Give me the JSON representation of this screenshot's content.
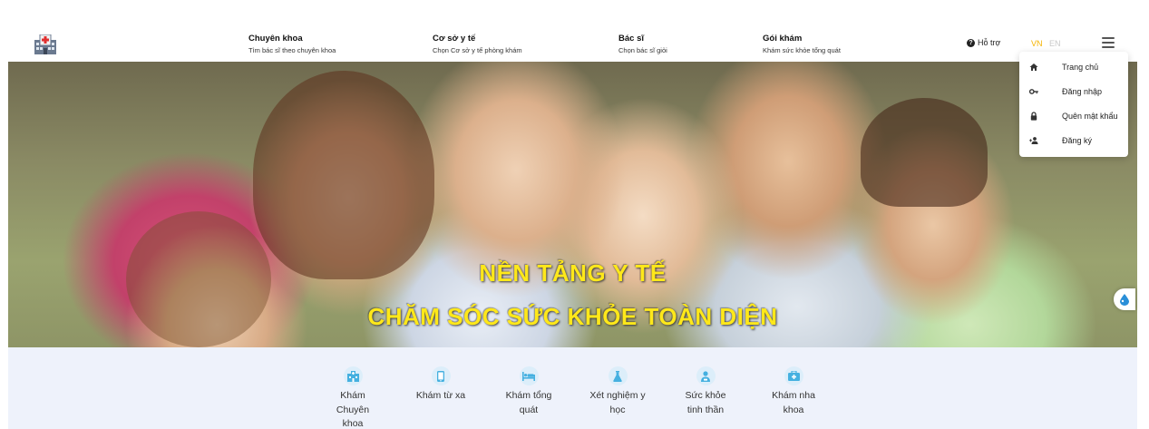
{
  "header": {
    "nav": [
      {
        "title": "Chuyên khoa",
        "subtitle": "Tìm bác sĩ theo chuyên khoa"
      },
      {
        "title": "Cơ sở y tế",
        "subtitle": "Chọn Cơ sở y tế phòng khám"
      },
      {
        "title": "Bác sĩ",
        "subtitle": "Chọn bác sĩ giỏi"
      },
      {
        "title": "Gói khám",
        "subtitle": "Khám sức khỏe tổng quát"
      }
    ],
    "support_label": "Hỗ trợ",
    "lang_vn": "VN",
    "lang_en": "EN",
    "active_lang_color": "#f5b400"
  },
  "dropdown": {
    "items": [
      {
        "label": "Trang chủ",
        "icon": "home-icon"
      },
      {
        "label": "Đăng nhập",
        "icon": "key-icon"
      },
      {
        "label": "Quên mật khẩu",
        "icon": "lock-icon"
      },
      {
        "label": "Đăng ký",
        "icon": "user-plus-icon"
      }
    ]
  },
  "hero": {
    "line1": "NỀN TẢNG Y TẾ",
    "line2": "CHĂM SÓC SỨC KHỎE TOÀN DIỆN",
    "text_color": "#ffe81a"
  },
  "services": [
    {
      "label": "Khám Chuyên khoa",
      "icon": "hospital-icon"
    },
    {
      "label": "Khám từ xa",
      "icon": "phone-icon"
    },
    {
      "label": "Khám tổng quát",
      "icon": "bed-icon"
    },
    {
      "label": "Xét nghiệm y học",
      "icon": "flask-icon"
    },
    {
      "label": "Sức khỏe tinh thần",
      "icon": "person-icon"
    },
    {
      "label": "Khám nha khoa",
      "icon": "medkit-icon"
    }
  ],
  "colors": {
    "accent_blue": "#45b0e0",
    "services_bg": "#eef2fb"
  }
}
